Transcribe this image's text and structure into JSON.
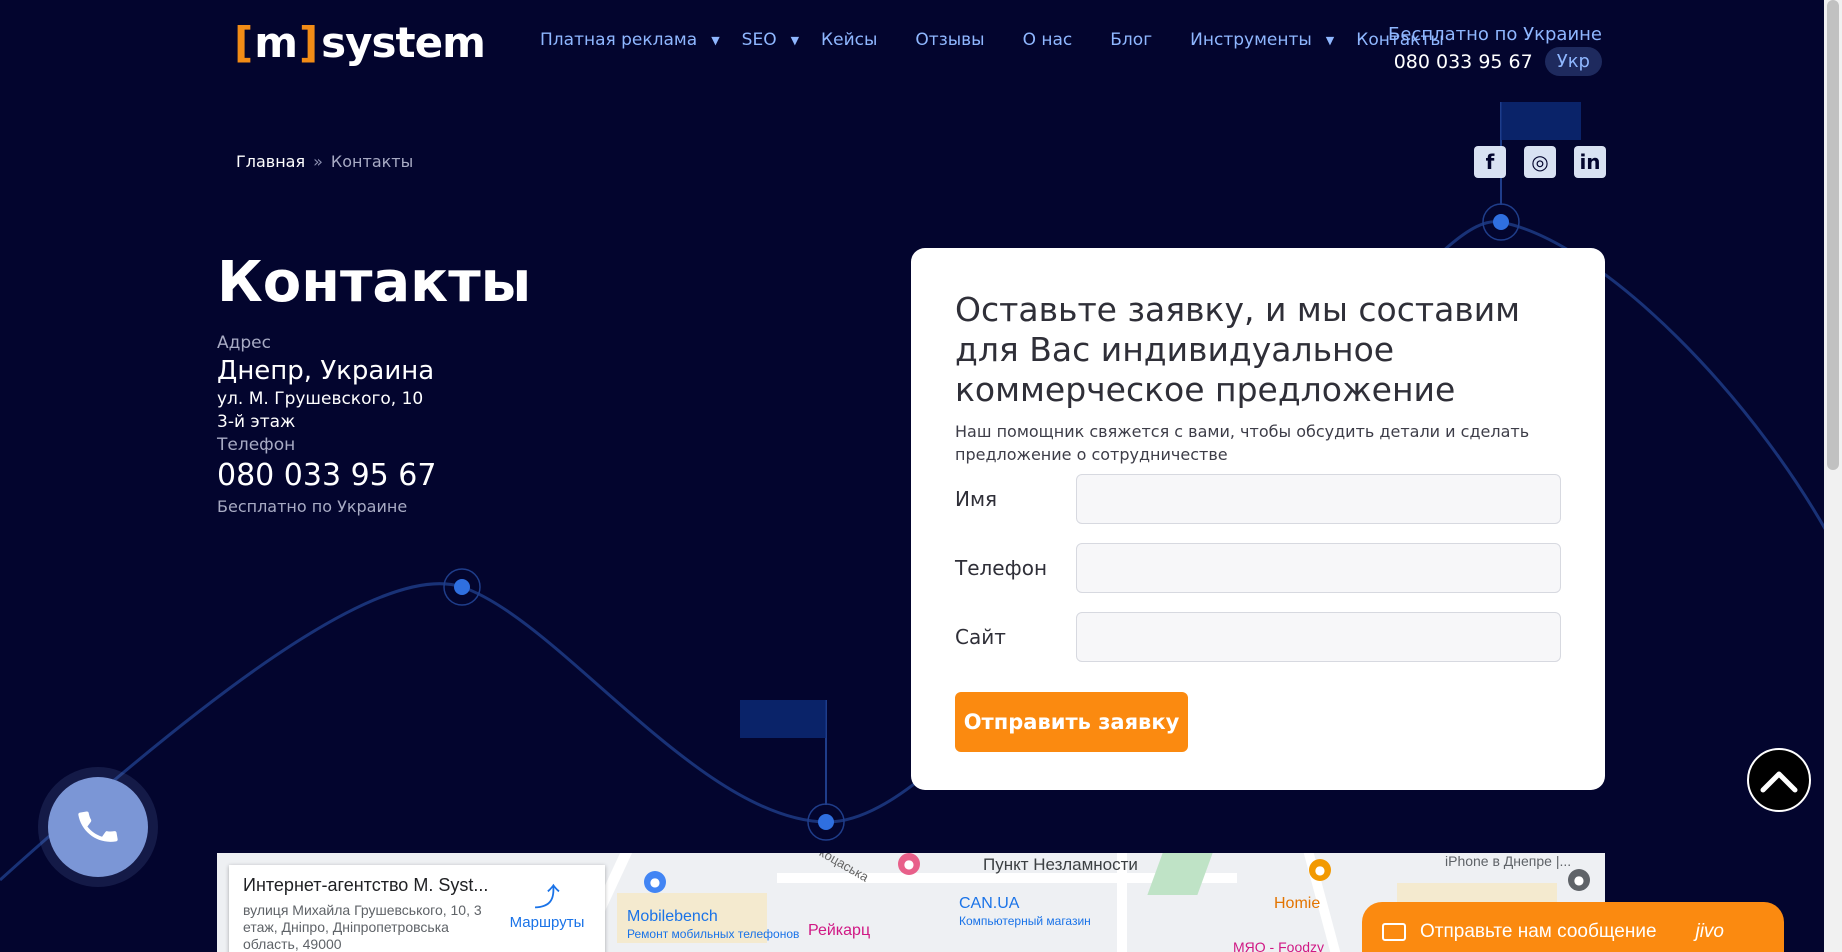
{
  "header": {
    "logo": {
      "open": "[",
      "m": "m",
      "close": "]",
      "word": "system"
    },
    "nav": [
      {
        "label": "Платная реклама",
        "has_submenu": true
      },
      {
        "label": "SEO",
        "has_submenu": true
      },
      {
        "label": "Кейсы",
        "has_submenu": false
      },
      {
        "label": "Отзывы",
        "has_submenu": false
      },
      {
        "label": "О нас",
        "has_submenu": false
      },
      {
        "label": "Блог",
        "has_submenu": false
      },
      {
        "label": "Инструменты",
        "has_submenu": true
      },
      {
        "label": "Контакты",
        "has_submenu": false
      }
    ],
    "free_text": "Бесплатно по Украине",
    "phone": "080 033 95 67",
    "lang": "Укр",
    "caret": "▼"
  },
  "breadcrumb": {
    "home": "Главная",
    "sep": "»",
    "current": "Контакты"
  },
  "social": {
    "facebook": "f",
    "instagram": "◎",
    "linkedin": "in"
  },
  "contacts": {
    "title": "Контакты",
    "address_label": "Адрес",
    "city": "Днепр, Украина",
    "street": "ул. М. Грушевского, 10",
    "floor": "3-й этаж",
    "phone_label": "Телефон",
    "phone": "080 033 95 67",
    "free_text": "Бесплатно по Украине"
  },
  "form": {
    "title": "Оставьте заявку, и мы составим для Вас индивидуальное коммерческое предложение",
    "subtitle": "Наш помощник свяжется с вами, чтобы обсудить детали и сделать предложение о сотрудничестве",
    "fields": [
      {
        "label": "Имя",
        "value": ""
      },
      {
        "label": "Телефон",
        "value": ""
      },
      {
        "label": "Сайт",
        "value": ""
      }
    ],
    "submit": "Отправить заявку"
  },
  "map": {
    "card_title": "Интернет-агентство M. Syst...",
    "card_address": "вулиця Михайла Грушевського, 10, 3 етаж, Дніпро, Дніпропетровська область, 49000",
    "route_label": "Маршруты",
    "labels": {
      "l1": "Пункт Незламности",
      "l2": "Mobilebench",
      "l3": "Ремонт мобильных телефонов",
      "l4": "Рейкарц",
      "l5": "CAN.UA",
      "l6": "Компьютерный магазин",
      "l7": "Homie",
      "l8": "iPhone в Днепре |...",
      "l9": "коцаська",
      "l10": "МЯО - Foodzy"
    }
  },
  "chat": {
    "label": "Отправьте нам сообщение",
    "brand": "jivo"
  },
  "colors": {
    "bg": "#03052e",
    "accent": "#fb8a10",
    "link": "#8fb7ff"
  }
}
